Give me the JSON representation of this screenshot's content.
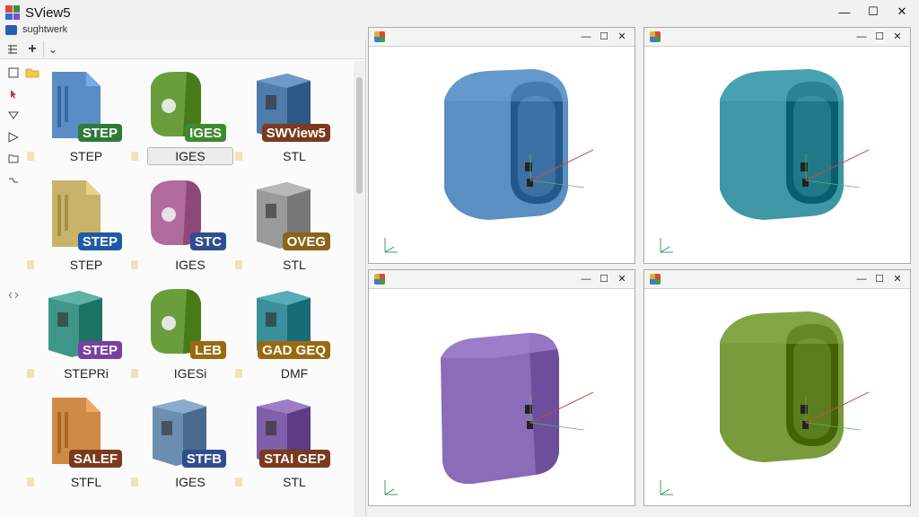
{
  "app": {
    "title": "SView5",
    "subtitle": "sughtwerk"
  },
  "window_controls": {
    "minimize": "—",
    "maximize": "☐",
    "close": "✕"
  },
  "toolbar": {
    "icons": [
      "layout-icon",
      "add-icon",
      "dropdown-icon"
    ],
    "add_label": "+",
    "dropdown_label": "⌄"
  },
  "side_tools": [
    "checkbox-icon",
    "folder-icon",
    "cursor-icon",
    "filter-icon",
    "funnel-icon",
    "folder-open-icon",
    "collapse-icon",
    "expand-icon"
  ],
  "files": [
    {
      "badge": "STEP",
      "label": "STEP",
      "badge_color": "#2f7a3a",
      "model_color": "#5a8dc6",
      "shape": "doc"
    },
    {
      "badge": "IGES",
      "label": "IGES",
      "badge_color": "#3f8a31",
      "model_color": "#6a9e3c",
      "shape": "blob",
      "selected": true
    },
    {
      "badge": "SWView5",
      "label": "STL",
      "badge_color": "#7a3a1e",
      "model_color": "#4f7ca8",
      "shape": "box"
    },
    {
      "badge": "STEP",
      "label": "STEP",
      "badge_color": "#1f5aa8",
      "model_color": "#c7b46a",
      "shape": "doc"
    },
    {
      "badge": "STC",
      "label": "IGES",
      "badge_color": "#2e4e8e",
      "model_color": "#b06b9c",
      "shape": "blob"
    },
    {
      "badge": "OVEG",
      "label": "STL",
      "badge_color": "#8a6418",
      "model_color": "#9a9a9a",
      "shape": "box"
    },
    {
      "badge": "STEP",
      "label": "STEPRi",
      "badge_color": "#7a3fa0",
      "model_color": "#3f9688",
      "shape": "box"
    },
    {
      "badge": "LEB",
      "label": "IGESi",
      "badge_color": "#9a6a10",
      "model_color": "#6a9e3c",
      "shape": "blob"
    },
    {
      "badge": "GAD GEQ",
      "label": "DMF",
      "badge_color": "#9a6a10",
      "model_color": "#3a8f9a",
      "shape": "box"
    },
    {
      "badge": "SALEF",
      "label": "STFL",
      "badge_color": "#7a3a1e",
      "model_color": "#d08a44",
      "shape": "doc"
    },
    {
      "badge": "STFB",
      "label": "IGES",
      "badge_color": "#2e4e8e",
      "model_color": "#6b8eb0",
      "shape": "box"
    },
    {
      "badge": "STAI GEP",
      "label": "STL",
      "badge_color": "#7a3a1e",
      "model_color": "#7e5fa8",
      "shape": "box"
    }
  ],
  "viewports": [
    {
      "model_color": "#5b8fc2",
      "controls": {
        "minimize": "—",
        "maximize": "☐",
        "close": "✕"
      }
    },
    {
      "model_color": "#3f97a6",
      "controls": {
        "minimize": "—",
        "maximize": "☐",
        "close": "✕"
      }
    },
    {
      "model_color": "#8a6cb8",
      "controls": {
        "minimize": "—",
        "maximize": "☐",
        "close": "✕"
      }
    },
    {
      "model_color": "#7a9b3c",
      "controls": {
        "minimize": "—",
        "maximize": "☐",
        "close": "✕"
      }
    }
  ]
}
